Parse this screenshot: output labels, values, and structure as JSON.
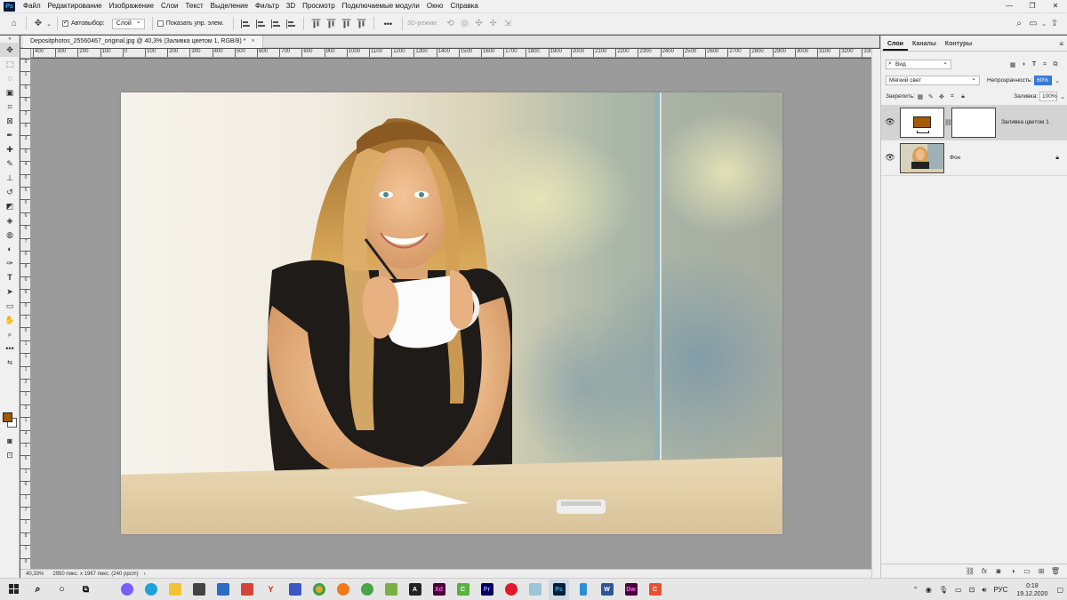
{
  "menubar": {
    "logo": "Ps",
    "items": [
      "Файл",
      "Редактирование",
      "Изображение",
      "Слои",
      "Текст",
      "Выделение",
      "Фильтр",
      "3D",
      "Просмотр",
      "Подключаемые модули",
      "Окно",
      "Справка"
    ],
    "window_controls": [
      "—",
      "❐",
      "✕"
    ]
  },
  "options": {
    "autoselect_label": "Автовыбор:",
    "autoselect_value": "Слой",
    "show_transform_label": "Показать упр. элем.",
    "mode_3d_label": "3D-режим:",
    "more": "•••"
  },
  "document": {
    "tab_title": "Depositphotos_25560467_original.jpg @ 40,3% (Заливка цветом 1, RGB/8) *",
    "close": "×"
  },
  "ruler": {
    "top_labels": [
      "400",
      "300",
      "200",
      "100",
      "0",
      "100",
      "200",
      "300",
      "400",
      "500",
      "600",
      "700",
      "800",
      "900",
      "1000",
      "1100",
      "1200",
      "1300",
      "1400",
      "1500",
      "1600",
      "1700",
      "1800",
      "1900",
      "2000",
      "2100",
      "2200",
      "2300",
      "2400",
      "2500",
      "2600",
      "2700",
      "2800",
      "2900",
      "3000",
      "3100",
      "3200",
      "3300"
    ],
    "left_labels": [
      "0",
      "1",
      "0",
      "0",
      "2",
      "0",
      "3",
      "0",
      "4",
      "0",
      "5",
      "0",
      "6",
      "0",
      "7",
      "0",
      "8",
      "0",
      "9",
      "0",
      "1",
      "0",
      "1",
      "1",
      "1",
      "2",
      "1",
      "3",
      "1",
      "4",
      "1",
      "5",
      "1",
      "6",
      "1",
      "7",
      "1",
      "8",
      "1",
      "9"
    ]
  },
  "status": {
    "zoom": "40,33%",
    "doc_info": "2950 пикс. x 1967 пикс. (240 ppcm)",
    "arrow": "›"
  },
  "layers_panel": {
    "tabs": [
      "Слои",
      "Каналы",
      "Контуры"
    ],
    "active_tab": "Слои",
    "filter_label": "Вид",
    "blend_mode": "Мягкий свет",
    "opacity_label": "Непрозрачность:",
    "opacity_value": "60%",
    "lock_label": "Закрепить:",
    "fill_label": "Заливка:",
    "fill_value": "100%",
    "layers": [
      {
        "name": "Заливка цветом 1",
        "selected": true
      },
      {
        "name": "Фон",
        "selected": false
      }
    ],
    "fill_color": "#a45c00"
  },
  "swatches": {
    "foreground": "#9a5a00",
    "background": "#ffffff"
  },
  "taskbar": {
    "lang": "РУС",
    "time": "0:18",
    "date": "19.12.2020"
  }
}
